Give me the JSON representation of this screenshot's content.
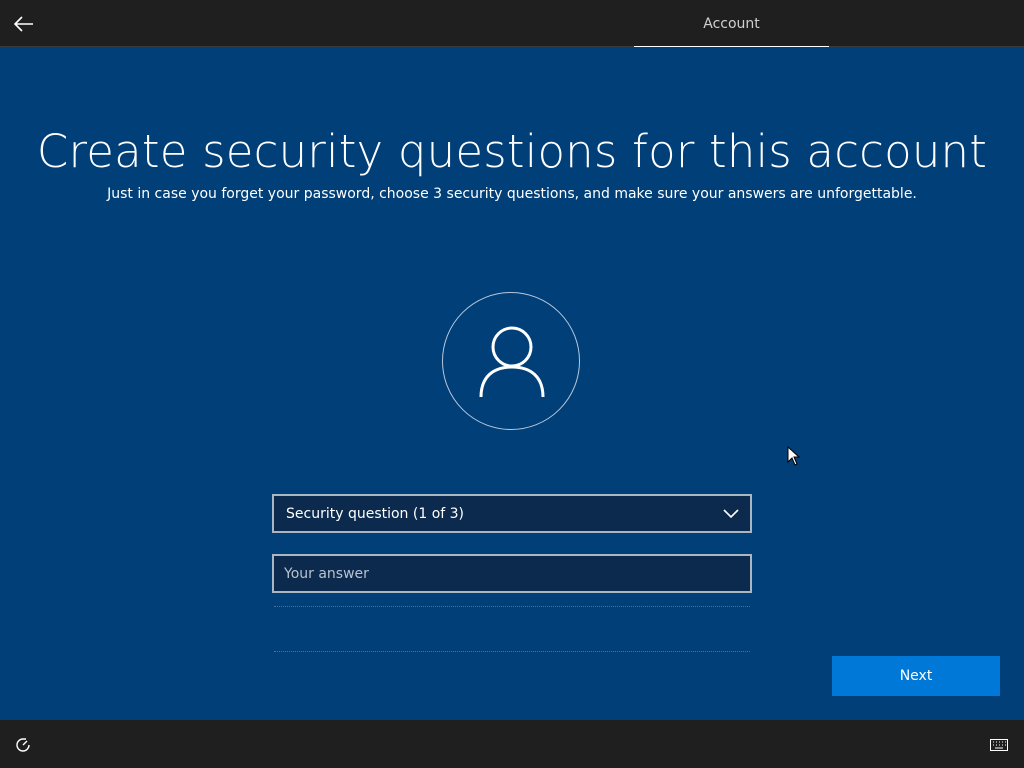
{
  "header": {
    "back_icon": "back-arrow-icon",
    "active_tab": "Account"
  },
  "main": {
    "title": "Create security questions for this account",
    "subtitle": "Just in case you forget your password, choose 3 security questions, and make sure your answers are unforgettable.",
    "avatar_icon": "user-icon",
    "security_question": {
      "selected": "Security question (1 of 3)",
      "icon": "chevron-down-icon"
    },
    "answer": {
      "value": "",
      "placeholder": "Your answer"
    },
    "next_label": "Next"
  },
  "footer": {
    "ease_of_access_icon": "ease-of-access-icon",
    "keyboard_icon": "keyboard-icon"
  },
  "colors": {
    "background": "#003f78",
    "bar": "#1f1f1f",
    "accent": "#0078d7",
    "field": "#0b2a4d"
  }
}
